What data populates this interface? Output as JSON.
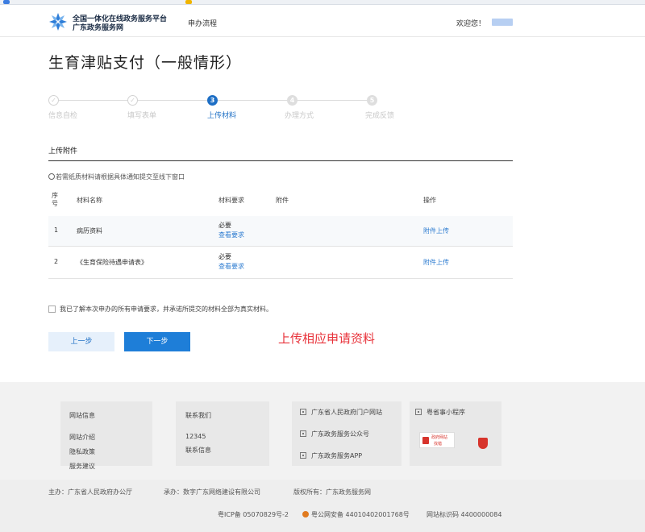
{
  "header": {
    "logo_line1": "全国一体化在线政务服务平台",
    "logo_line2": "广东政务服务网",
    "nav_flow": "申办流程",
    "welcome": "欢迎您！"
  },
  "page_title": "生育津贴支付（一般情形）",
  "steps": [
    {
      "num": "✓",
      "label": "信息自检",
      "state": "done"
    },
    {
      "num": "✓",
      "label": "填写表单",
      "state": "done"
    },
    {
      "num": "3",
      "label": "上传材料",
      "state": "active"
    },
    {
      "num": "4",
      "label": "办理方式",
      "state": "future"
    },
    {
      "num": "5",
      "label": "完成反馈",
      "state": "future"
    }
  ],
  "section_title": "上传附件",
  "notice": "若需纸质材料请根据具体通知提交至线下窗口",
  "table": {
    "headers": {
      "seq": "序号",
      "name": "材料名称",
      "req": "材料要求",
      "attach": "附件",
      "op": "操作"
    },
    "rows": [
      {
        "seq": "1",
        "name": "病历资料",
        "req": "必要",
        "view": "查看要求",
        "op": "附件上传"
      },
      {
        "seq": "2",
        "name": "《生育保险待遇申请表》",
        "req": "必要",
        "view": "查看要求",
        "op": "附件上传"
      }
    ]
  },
  "agree_text": "我已了解本次申办的所有申请要求，并承诺所提交的材料全部为真实材料。",
  "buttons": {
    "prev": "上一步",
    "next": "下一步"
  },
  "annotation": "上传相应申请资料",
  "footer": {
    "site_info": {
      "title": "网站信息",
      "items": [
        "网站介绍",
        "隐私政策",
        "服务建议"
      ]
    },
    "contact": {
      "title": "联系我们",
      "items": [
        "12345",
        "联系信息"
      ]
    },
    "links": [
      "广东省人民政府门户网站",
      "广东政务服务公众号",
      "广东政务服务APP"
    ],
    "mini_program": "粤省事小程序",
    "gov_badge_line1": "政府网站",
    "gov_badge_line2": "找错",
    "sponsor": "主办：广东省人民政府办公厅",
    "builder": "承办：数字广东网络建设有限公司",
    "copyright": "版权所有：广东政务服务网",
    "icp": "粤ICP备 05070829号-2",
    "police": "粤公网安备 44010402001768号",
    "site_code": "网站标识码 4400000084"
  },
  "colors": {
    "primary": "#1e7ed8",
    "annotation": "#e8323a"
  }
}
